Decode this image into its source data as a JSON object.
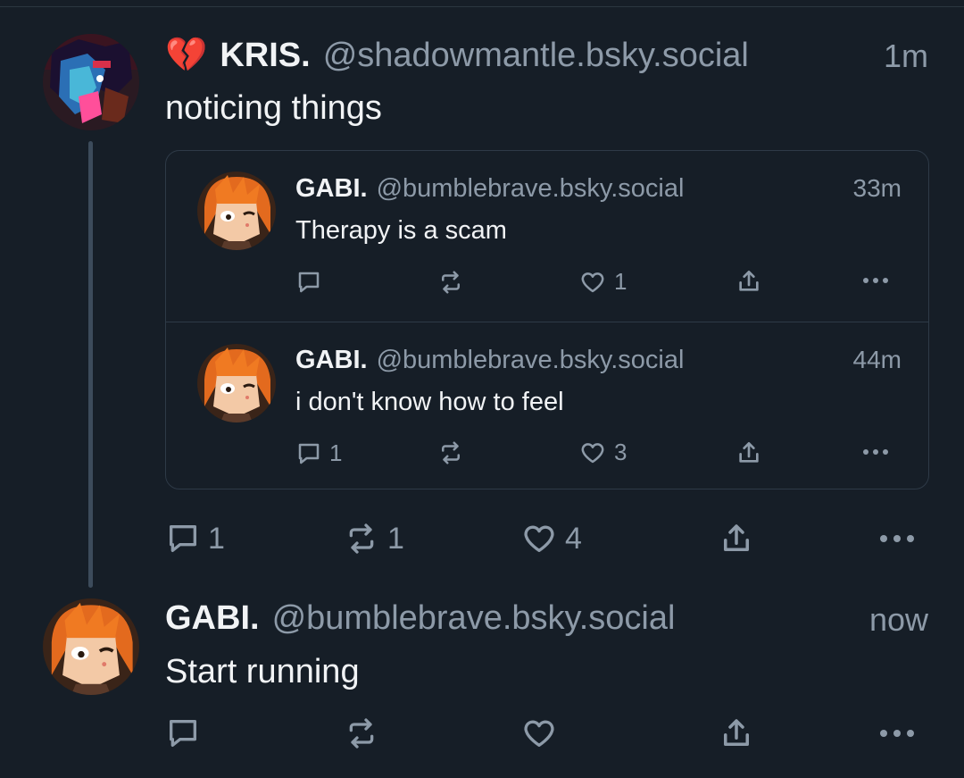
{
  "main_post": {
    "emoji": "💔",
    "author_name": "KRIS.",
    "handle": "@shadowmantle.bsky.social",
    "time": "1m",
    "text": "noticing things",
    "replies": "1",
    "reposts": "1",
    "likes": "4"
  },
  "quoted_posts": [
    {
      "author_name": "GABI.",
      "handle": "@bumblebrave.bsky.social",
      "time": "33m",
      "text": "Therapy is a scam",
      "replies": "",
      "reposts": "",
      "likes": "1"
    },
    {
      "author_name": "GABI.",
      "handle": "@bumblebrave.bsky.social",
      "time": "44m",
      "text": "i don't know how to feel",
      "replies": "1",
      "reposts": "",
      "likes": "3"
    }
  ],
  "reply_post": {
    "author_name": "GABI.",
    "handle": "@bumblebrave.bsky.social",
    "time": "now",
    "text": "Start running",
    "replies": "",
    "reposts": "",
    "likes": ""
  },
  "icons": {
    "reply": "speech-bubble-icon",
    "repost": "repost-arrows-icon",
    "like": "heart-icon",
    "share": "share-upload-icon",
    "more": "ellipsis-icon"
  },
  "colors": {
    "background": "#161e27",
    "muted_text": "#8d9aa8",
    "thread_line": "#3c4b5b",
    "border": "#2e3a47"
  }
}
